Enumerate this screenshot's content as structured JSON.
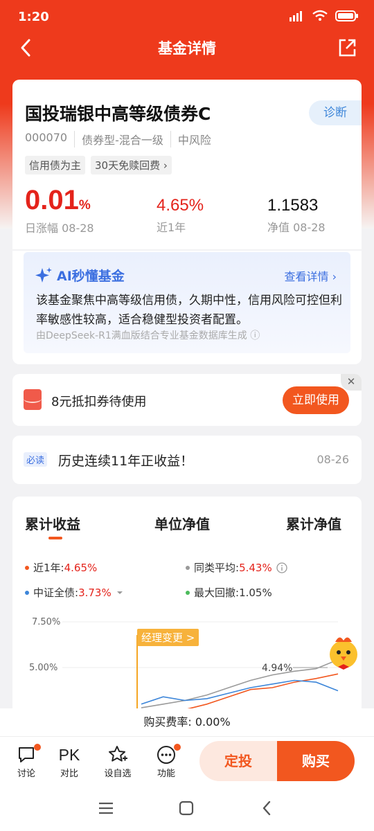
{
  "status": {
    "time": "1:20"
  },
  "nav": {
    "title": "基金详情"
  },
  "fund": {
    "name": "国投瑞银中高等级债券C",
    "code": "000070",
    "type": "债券型-混合一级",
    "risk": "中风险",
    "tags": [
      "信用债为主",
      "30天免赎回费 ›"
    ],
    "diagnose": "诊断",
    "daily_change": "0.01",
    "daily_unit": "%",
    "daily_label": "日涨幅 08-28",
    "year_return": "4.65%",
    "year_label": "近1年",
    "nav_value": "1.1583",
    "nav_label": "净值 08-28"
  },
  "ai": {
    "title": "AI秒懂基金",
    "more": "查看详情 ›",
    "text": "该基金聚焦中高等级信用债，久期中性，信用风险可控但利率敏感性较高，适合稳健型投资者配置。",
    "source": "由DeepSeek-R1满血版结合专业基金数据库生成 ⓘ"
  },
  "coupon": {
    "text": "8元抵扣券待使用",
    "button": "立即使用",
    "close": "✕"
  },
  "news": {
    "badge": "必读",
    "text": "历史连续11年正收益！",
    "date": "08-26"
  },
  "chart": {
    "tabs": [
      "累计收益",
      "单位净值",
      "累计净值"
    ],
    "legend": {
      "year_label": "近1年:",
      "year_value": "4.65%",
      "avg_label": "同类平均:",
      "avg_value": "5.43%",
      "index_label": "中证全债:",
      "index_value": "3.73%",
      "drawdown_label": "最大回撤:",
      "drawdown_value": "1.05%"
    },
    "yticks": [
      "7.50%",
      "5.00%"
    ],
    "manager_change": "经理变更 >",
    "point_label": "4.94%",
    "colors": {
      "fund": "#f2571f",
      "avg": "#9a9a9a",
      "index": "#3d86d9",
      "drawdown": "#4cbb5c"
    }
  },
  "chart_data": {
    "type": "line",
    "ylim": [
      2.5,
      7.5
    ],
    "series": [
      {
        "name": "近1年",
        "values": [
          2.6,
          2.6,
          2.7,
          3.0,
          3.4,
          3.8,
          3.9,
          4.2,
          4.4,
          4.65
        ]
      },
      {
        "name": "同类平均",
        "values": [
          2.8,
          3.0,
          3.2,
          3.5,
          3.9,
          4.3,
          4.6,
          4.8,
          4.94,
          5.43
        ]
      },
      {
        "name": "中证全债",
        "values": [
          3.0,
          3.4,
          3.2,
          3.3,
          3.6,
          3.9,
          4.1,
          4.3,
          4.2,
          3.73
        ]
      }
    ]
  },
  "fee": {
    "text": "购买费率: 0.00%"
  },
  "bottom": {
    "items": [
      "讨论",
      "对比",
      "设自选",
      "功能"
    ],
    "pk": "PK",
    "dingtou": "定投",
    "buy": "购买"
  }
}
